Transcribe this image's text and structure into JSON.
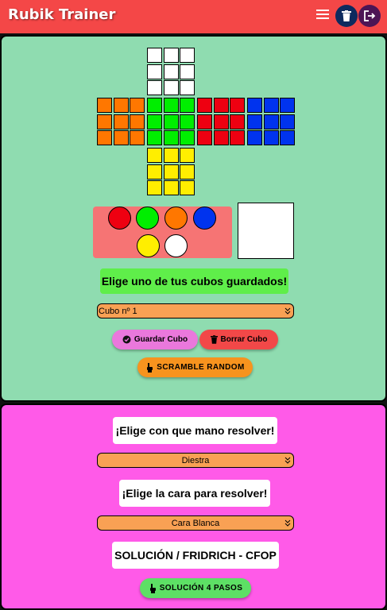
{
  "header": {
    "title": "Rubik Trainer",
    "bg_color": "#f44747"
  },
  "cube": {
    "colors": {
      "W": "#ffffff",
      "O": "#ff7700",
      "G": "#00ee00",
      "R": "#ee0011",
      "B": "#0033ee",
      "Y": "#ffee00"
    },
    "faces": {
      "up": [
        "W",
        "W",
        "W",
        "W",
        "W",
        "W",
        "W",
        "W",
        "W"
      ],
      "left": [
        "O",
        "O",
        "O",
        "O",
        "O",
        "O",
        "O",
        "O",
        "O"
      ],
      "front": [
        "G",
        "G",
        "G",
        "G",
        "G",
        "G",
        "G",
        "G",
        "G"
      ],
      "right": [
        "R",
        "R",
        "R",
        "R",
        "R",
        "R",
        "R",
        "R",
        "R"
      ],
      "back": [
        "B",
        "B",
        "B",
        "B",
        "B",
        "B",
        "B",
        "B",
        "B"
      ],
      "down": [
        "Y",
        "Y",
        "Y",
        "Y",
        "Y",
        "Y",
        "Y",
        "Y",
        "Y"
      ]
    }
  },
  "palette": {
    "swatches": [
      "#ee0011",
      "#00ee00",
      "#ff7700",
      "#0033ee",
      "#ffee00",
      "#ffffff"
    ],
    "selected_color": "#ffffff"
  },
  "saved_cubes": {
    "heading": "Elige uno de tus cubos guardados!",
    "selected": "Cubo nº 1"
  },
  "buttons": {
    "save": "Guardar Cubo",
    "delete": "Borrar Cubo",
    "scramble": "SCRAMBLE RANDOM",
    "solution4": "SOLUCIÓN 4 PASOS"
  },
  "solve": {
    "hand_heading": "¡Elige con que mano resolver!",
    "hand_selected": "Diestra",
    "face_heading": "¡Elige la cara para resolver!",
    "face_selected": "Cara Blanca",
    "method_heading": "SOLUCIÓN / FRIDRICH - CFOP"
  }
}
